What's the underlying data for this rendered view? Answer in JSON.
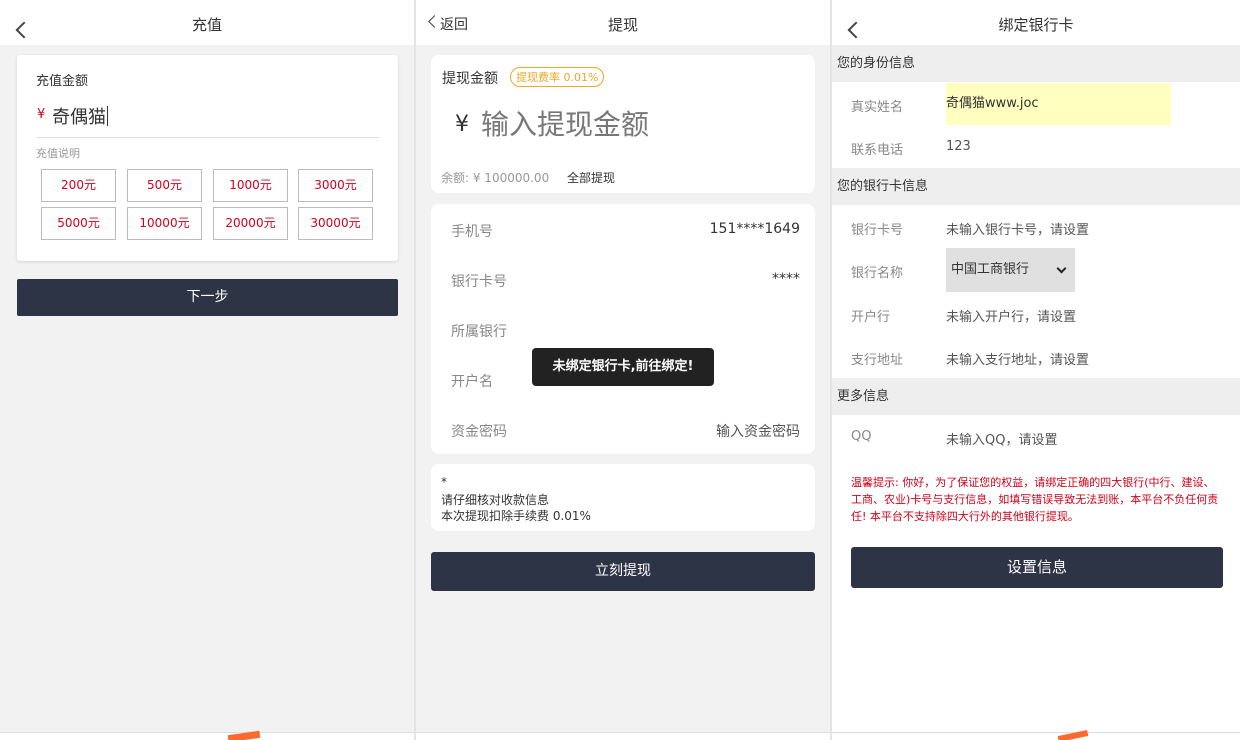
{
  "recharge": {
    "title": "充值",
    "amount_label": "充值金额",
    "currency": "¥",
    "amount_value": "奇偶猫",
    "note_label": "充值说明",
    "chips": [
      "200元",
      "500元",
      "1000元",
      "3000元",
      "5000元",
      "10000元",
      "20000元",
      "30000元"
    ],
    "next_label": "下一步"
  },
  "withdraw": {
    "back_label": "返回",
    "title": "提现",
    "amount_label": "提现金额",
    "fee_badge": "提现费率 0.01%",
    "currency": "¥",
    "amount_placeholder": "输入提现金额",
    "balance_text": "余额: ¥ 100000.00",
    "withdraw_all": "全部提现",
    "rows": [
      {
        "label": "手机号",
        "value": "151****1649"
      },
      {
        "label": "银行卡号",
        "value": "****"
      },
      {
        "label": "所属银行",
        "value": ""
      },
      {
        "label": "开户名",
        "value": ""
      },
      {
        "label": "资金密码",
        "value": "输入资金密码"
      }
    ],
    "toast": "未绑定银行卡,前往绑定!",
    "tips": [
      "*",
      "请仔细核对收款信息",
      "本次提现扣除手续费 0.01%"
    ],
    "submit_label": "立刻提现"
  },
  "bind": {
    "title": "绑定银行卡",
    "section_identity": "您的身份信息",
    "name_label": "真实姓名",
    "name_value": "奇偶猫www.joc",
    "phone_label": "联系电话",
    "phone_value": "123",
    "section_bank": "您的银行卡信息",
    "card_label": "银行卡号",
    "card_value": "未输入银行卡号，请设置",
    "bank_label": "银行名称",
    "bank_selected": "中国工商银行",
    "branch_label": "开户行",
    "branch_value": "未输入开户行，请设置",
    "address_label": "支行地址",
    "address_value": "未输入支行地址，请设置",
    "section_more": "更多信息",
    "qq_label": "QQ",
    "qq_value": "未输入QQ，请设置",
    "warning": "温馨提示: 你好，为了保证您的权益，请绑定正确的四大银行(中行、建设、工商、农业)卡号与支行信息，如填写错误导致无法到账，本平台不负任何责任! 本平台不支持除四大行外的其他银行提现。",
    "submit_label": "设置信息"
  },
  "colors": {
    "accent_red": "#d0021b",
    "button_dark": "#2d3446",
    "badge_orange": "#f5a623",
    "highlight_yellow": "#ffffc0"
  }
}
